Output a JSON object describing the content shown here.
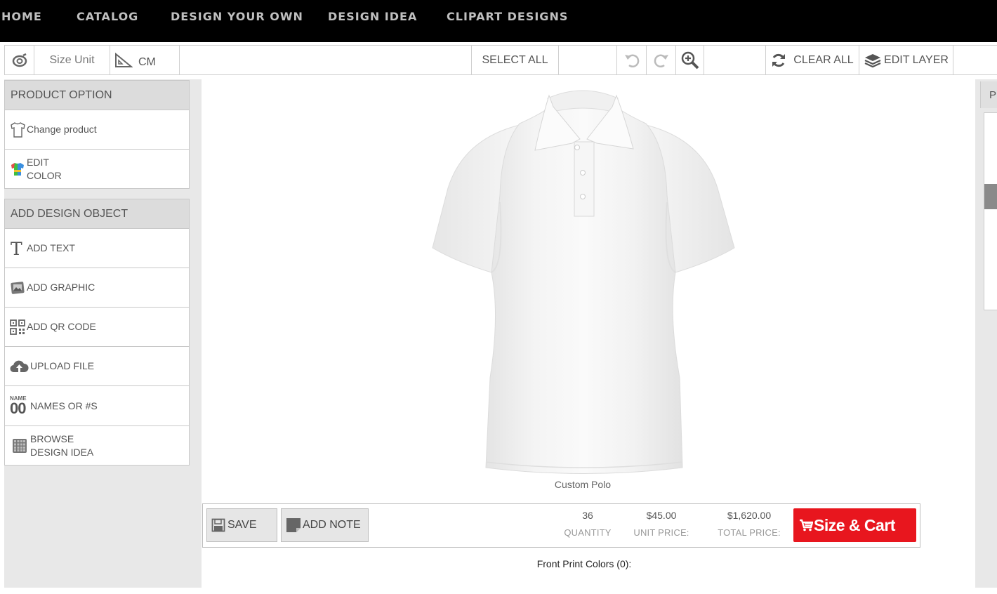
{
  "nav": {
    "items": [
      "HOME",
      "CATALOG",
      "DESIGN YOUR OWN",
      "DESIGN IDEA",
      "CLIPART DESIGNS"
    ]
  },
  "toolbar": {
    "size_unit_label": "Size Unit",
    "size_unit_value": "CM",
    "select_all": "SELECT ALL",
    "clear_all": "CLEAR ALL",
    "edit_layer": "EDIT LAYER"
  },
  "left": {
    "product_option_header": "PRODUCT OPTION",
    "change_product": "Change product",
    "edit_color_line1": "EDIT",
    "edit_color_line2": "COLOR",
    "add_design_header": "ADD DESIGN OBJECT",
    "add_text": "ADD TEXT",
    "add_graphic": "ADD GRAPHIC",
    "add_qr": "ADD QR CODE",
    "upload_file": "UPLOAD FILE",
    "names_or_numbers": "NAMES OR #S",
    "names_icon_top": "NAME",
    "names_icon_bottom": "00",
    "browse_line1": "BROWSE",
    "browse_line2": "DESIGN IDEA"
  },
  "canvas": {
    "product_name": "Custom Polo"
  },
  "bottom": {
    "save": "SAVE",
    "add_note": "ADD NOTE",
    "quantity_value": "36",
    "quantity_label": "QUANTITY",
    "unit_price_value": "$45.00",
    "unit_price_label": "UNIT PRICE:",
    "total_price_value": "$1,620.00",
    "total_price_label": "TOTAL PRICE:",
    "cart_button": "Size & Cart",
    "print_colors": "Front Print Colors  (0):"
  },
  "right": {
    "tab_label": "P"
  },
  "colors": {
    "nav_bg": "#000000",
    "cart_red": "#e8161e",
    "panel_gray": "#e8e8e8"
  }
}
